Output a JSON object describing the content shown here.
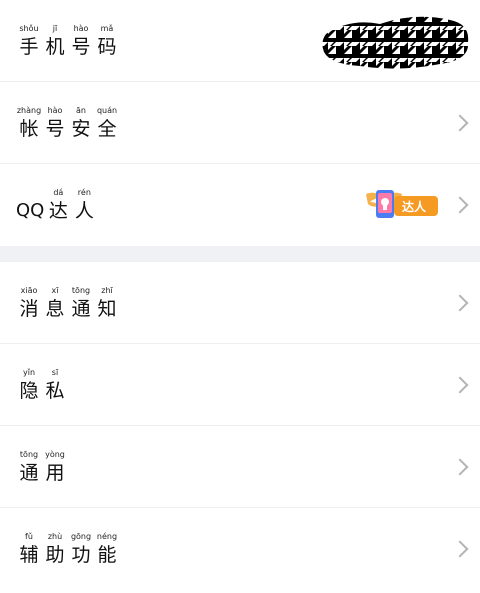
{
  "account_group": [
    {
      "id": "phone",
      "chars": [
        {
          "py": "shǒu",
          "hz": "手"
        },
        {
          "py": "jī",
          "hz": "机"
        },
        {
          "py": "hào",
          "hz": "号"
        },
        {
          "py": "mǎ",
          "hz": "码"
        }
      ]
    },
    {
      "id": "security",
      "chars": [
        {
          "py": "zhàng",
          "hz": "帐"
        },
        {
          "py": "hào",
          "hz": "号"
        },
        {
          "py": "ān",
          "hz": "安"
        },
        {
          "py": "quán",
          "hz": "全"
        }
      ]
    },
    {
      "id": "qq-daren",
      "prefix": "QQ",
      "chars": [
        {
          "py": "dá",
          "hz": "达"
        },
        {
          "py": "rén",
          "hz": "人"
        }
      ],
      "badge_text": "达人"
    }
  ],
  "settings_group": [
    {
      "id": "notifications",
      "chars": [
        {
          "py": "xiāo",
          "hz": "消"
        },
        {
          "py": "xī",
          "hz": "息"
        },
        {
          "py": "tōng",
          "hz": "通"
        },
        {
          "py": "zhī",
          "hz": "知"
        }
      ]
    },
    {
      "id": "privacy",
      "chars": [
        {
          "py": "yǐn",
          "hz": "隐"
        },
        {
          "py": "sī",
          "hz": "私"
        }
      ]
    },
    {
      "id": "general",
      "chars": [
        {
          "py": "tōng",
          "hz": "通"
        },
        {
          "py": "yòng",
          "hz": "用"
        }
      ]
    },
    {
      "id": "accessibility",
      "chars": [
        {
          "py": "fǔ",
          "hz": "辅"
        },
        {
          "py": "zhù",
          "hz": "助"
        },
        {
          "py": "gōng",
          "hz": "功"
        },
        {
          "py": "néng",
          "hz": "能"
        }
      ]
    }
  ],
  "colors": {
    "divider": "#eff1f5",
    "chevron": "#b4b4b4",
    "badge_orange": "#f59a23",
    "badge_blue": "#4a7cf3"
  }
}
